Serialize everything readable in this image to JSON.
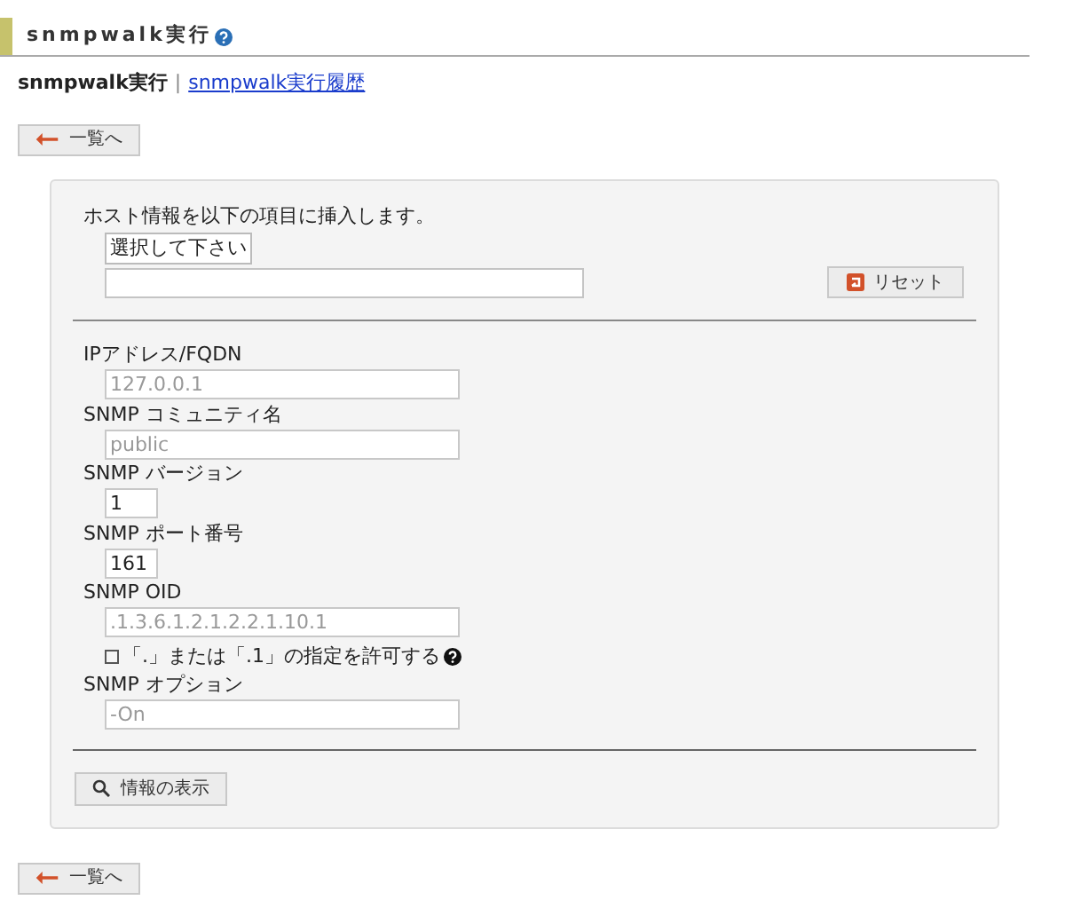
{
  "header": {
    "title": "snmpwalk実行"
  },
  "nav": {
    "current": "snmpwalk実行",
    "separator": "|",
    "link": "snmpwalk実行履歴"
  },
  "back_button_top": "一覧へ",
  "host_insert": {
    "text": "ホスト情報を以下の項目に挿入します。",
    "select": "選択して下さい",
    "reset_button": "リセット"
  },
  "fields": [
    {
      "kind": "wide",
      "label": "IPアドレス/FQDN",
      "placeholder": "127.0.0.1"
    },
    {
      "kind": "wide",
      "label": "SNMP コミュニティ名",
      "placeholder": "public"
    },
    {
      "kind": "narrow",
      "label": "SNMP バージョン",
      "value": "1"
    },
    {
      "kind": "narrow",
      "label": "SNMP ポート番号",
      "value": "161"
    },
    {
      "kind": "wide",
      "label": "SNMP OID",
      "placeholder": ".1.3.6.1.2.1.2.2.1.10.1",
      "option": {
        "label": "「.」または「.1」の指定を許可する",
        "checked": false
      }
    },
    {
      "kind": "wide",
      "label": "SNMP オプション",
      "placeholder": "-On"
    }
  ],
  "show_button": "情報の表示",
  "back_button_bottom": "一覧へ"
}
